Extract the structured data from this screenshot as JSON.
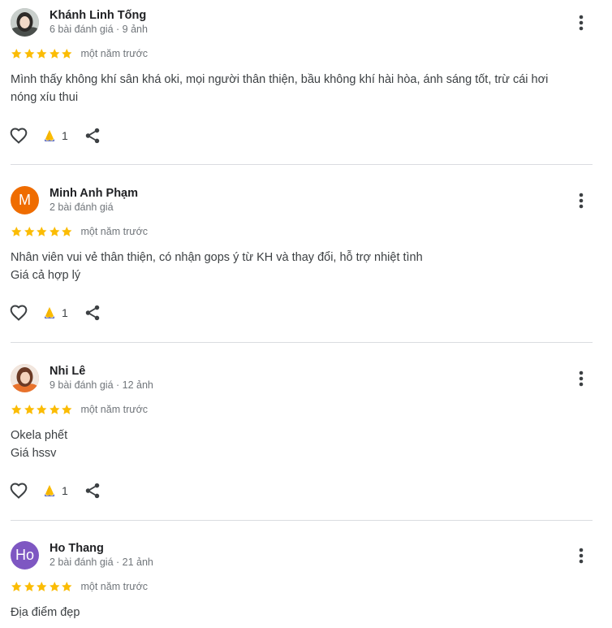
{
  "reviews": [
    {
      "name": "Khánh Linh Tống",
      "meta": "6 bài đánh giá · 9 ảnh",
      "time": "một năm trước",
      "rating": 5,
      "avatar": {
        "type": "photo",
        "letter": "",
        "color": "#9aa3a0"
      },
      "text_lines": [
        "Mình thấy không khí sân khá oki, mọi người thân thiện, bầu không khí hài hòa, ánh sáng tốt, trừ cái hơi",
        "nóng xíu thui"
      ],
      "reaction_count": "1"
    },
    {
      "name": "Minh Anh Phạm",
      "meta": "2 bài đánh giá",
      "time": "một năm trước",
      "rating": 5,
      "avatar": {
        "type": "letter",
        "letter": "M",
        "color": "#ef6c00"
      },
      "text_lines": [
        "Nhân viên vui vẻ thân thiện, có nhận gops ý từ KH và thay đổi, hỗ trợ nhiệt tình",
        "Giá cả hợp lý"
      ],
      "reaction_count": "1"
    },
    {
      "name": "Nhi Lê",
      "meta": "9 bài đánh giá · 12 ảnh",
      "time": "một năm trước",
      "rating": 5,
      "avatar": {
        "type": "photo",
        "letter": "",
        "color": "#e8a27a"
      },
      "text_lines": [
        "Okela phết",
        "Giá hssv"
      ],
      "reaction_count": "1"
    },
    {
      "name": "Ho Thang",
      "meta": "2 bài đánh giá · 21 ảnh",
      "time": "một năm trước",
      "rating": 5,
      "avatar": {
        "type": "letter",
        "letter": "Ho",
        "color": "#7e57c2"
      },
      "text_lines": [
        "Địa điểm đẹp"
      ],
      "reaction_count": ""
    }
  ],
  "icons": {
    "star": "star-icon",
    "like": "heart-outline-icon",
    "reaction": "clapping-hands-icon",
    "share": "share-icon",
    "more": "more-vertical-icon"
  },
  "colors": {
    "star": "#fbbc04",
    "text": "#3c4043",
    "meta": "#70757a",
    "divider": "#dadce0",
    "icon": "#3c4043"
  }
}
